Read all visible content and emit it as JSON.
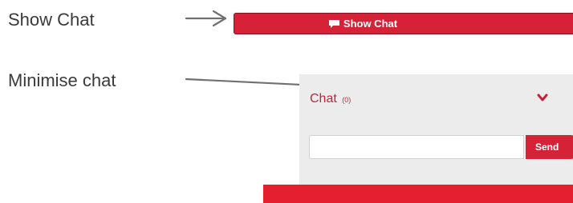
{
  "annotations": {
    "show_chat": "Show Chat",
    "minimise_chat": "Minimise chat"
  },
  "show_chat_button": {
    "label": "Show Chat",
    "icon": "speech-bubble-icon"
  },
  "chat_panel": {
    "title": "Chat",
    "count": "(0)",
    "minimise_icon": "chevron-down-icon",
    "input_value": "",
    "send_label": "Send"
  },
  "colors": {
    "accent": "#d52237",
    "panel_bg": "#ececec",
    "annotation_text": "#3a3a3a"
  }
}
